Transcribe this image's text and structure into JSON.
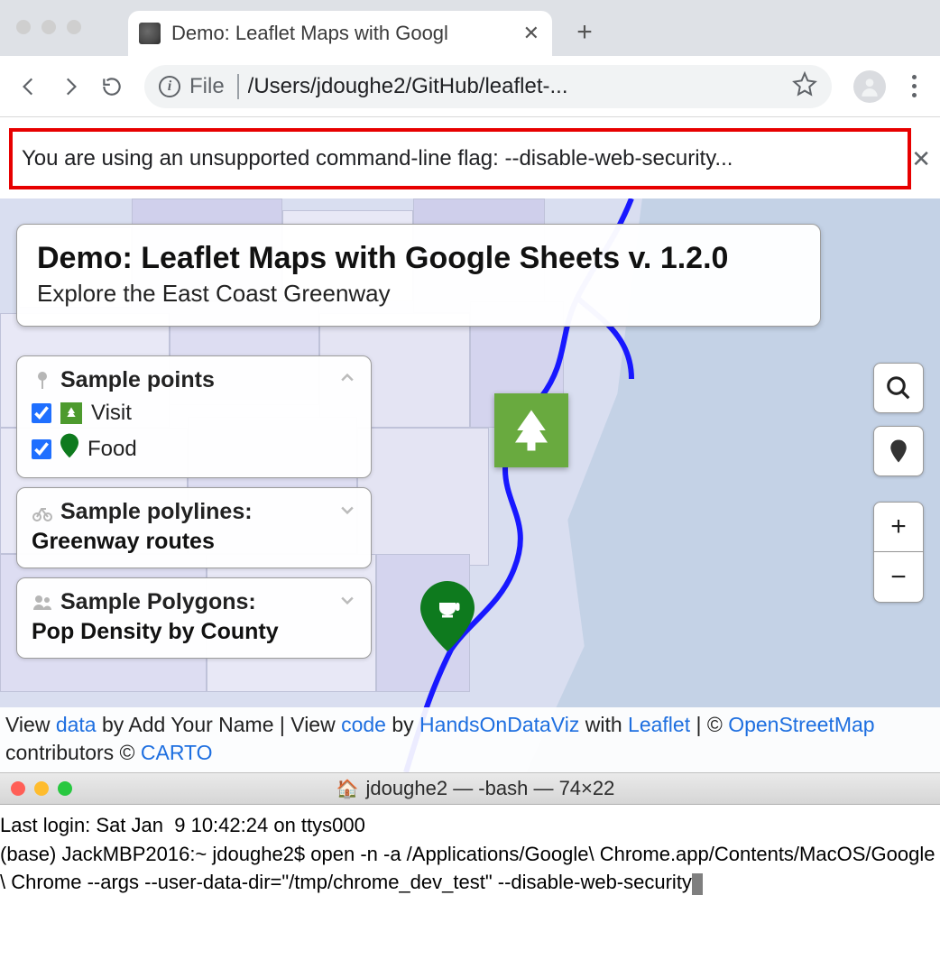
{
  "browser": {
    "tab_title": "Demo: Leaflet Maps with Googl",
    "omni_scheme": "File",
    "omni_path": "/Users/jdoughe2/GitHub/leaflet-...",
    "new_tab_glyph": "+"
  },
  "infobar": {
    "text": "You are using an unsupported command-line flag: --disable-web-security..."
  },
  "map": {
    "title": "Demo: Leaflet Maps with Google Sheets v. 1.2.0",
    "subtitle": "Explore the East Coast Greenway",
    "legend": {
      "points_header": "Sample points",
      "items": [
        {
          "label": "Visit",
          "checked": true,
          "icon": "tree"
        },
        {
          "label": "Food",
          "checked": true,
          "icon": "pin"
        }
      ],
      "polylines_header": "Sample polylines:",
      "polylines_sub": "Greenway routes",
      "polygons_header": "Sample Polygons:",
      "polygons_sub": "Pop Density by County"
    },
    "controls": {
      "zoom_in": "+",
      "zoom_out": "−"
    },
    "attribution": {
      "t1": "View ",
      "link_data": "data",
      "t2": " by Add Your Name | View ",
      "link_code": "code",
      "t3": " by ",
      "link_hdv": "HandsOnDataViz",
      "t4": " with ",
      "link_leaflet": "Leaflet",
      "t5": " | © ",
      "link_osm": "OpenStreetMap",
      "t6": " contributors © ",
      "link_carto": "CARTO"
    }
  },
  "terminal": {
    "title": "jdoughe2 — -bash — 74×22",
    "line1": "Last login: Sat Jan  9 10:42:24 on ttys000",
    "line2": "(base) JackMBP2016:~ jdoughe2$ open -n -a /Applications/Google\\ Chrome.app/Contents/MacOS/Google\\ Chrome --args --user-data-dir=\"/tmp/chrome_dev_test\" --disable-web-security"
  }
}
